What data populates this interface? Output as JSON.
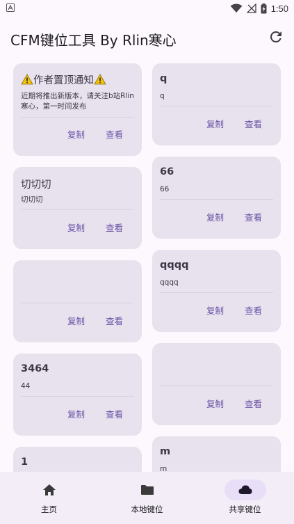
{
  "status_bar": {
    "time": "1:50"
  },
  "app_bar": {
    "title": "CFM键位工具   By Rlin寒心"
  },
  "actions": {
    "copy": "复制",
    "view": "查看"
  },
  "cards_left": [
    {
      "title": "作者置顶通知",
      "desc": "近期将推出新版本，请关注b站Rlin寒心，第一时间发布",
      "warning": true
    },
    {
      "title": "切切切",
      "desc": "切切切"
    },
    {
      "title": "",
      "desc": ""
    },
    {
      "title": "3464",
      "desc": "44"
    },
    {
      "title": "1",
      "desc": ""
    }
  ],
  "cards_right": [
    {
      "title": "q",
      "desc": "q"
    },
    {
      "title": "66",
      "desc": "66"
    },
    {
      "title": "qqqq",
      "desc": "qqqq"
    },
    {
      "title": "",
      "desc": ""
    },
    {
      "title": "m",
      "desc": "m"
    }
  ],
  "bottom_nav": [
    {
      "label": "主页",
      "icon": "home-icon",
      "active": false
    },
    {
      "label": "本地键位",
      "icon": "folder-icon",
      "active": false
    },
    {
      "label": "共享键位",
      "icon": "cloud-icon",
      "active": true
    }
  ],
  "colors": {
    "accent": "#6750a4",
    "card": "#e8e1ee",
    "background": "#fdf8fe",
    "nav": "#f3edf7",
    "nav_active": "#e8def8"
  }
}
